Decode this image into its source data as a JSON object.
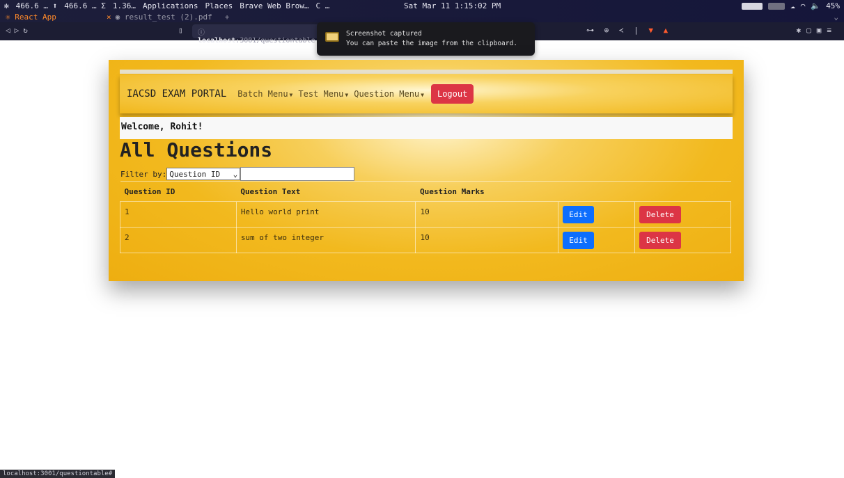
{
  "system_bar": {
    "items": [
      "466.6 … ⬆",
      "466.6 … Σ",
      "1.36…",
      "Applications",
      "Places",
      "Brave Web Brow…",
      "C …"
    ],
    "clock": "Sat Mar 11  1:15:02 PM",
    "battery": "45%"
  },
  "browser": {
    "tabs": [
      {
        "label": "React App",
        "active": true
      },
      {
        "label": "result_test (2).pdf",
        "active": false
      }
    ],
    "url_host": "localhost",
    "url_path": ":3001/questiontable",
    "status_url": "localhost:3001/questiontable#"
  },
  "toast": {
    "title": "Screenshot captured",
    "message": "You can paste the image from the clipboard."
  },
  "app_nav": {
    "brand": "IACSD EXAM PORTAL",
    "menus": [
      "Batch Menu",
      "Test Menu",
      "Question Menu"
    ],
    "logout": "Logout"
  },
  "welcome": "Welcome, Rohit!",
  "page_title": "All Questions",
  "filter": {
    "label": "Filter by:",
    "selected": "Question ID",
    "value": ""
  },
  "table": {
    "headers": [
      "Question ID",
      "Question Text",
      "Question Marks",
      ""
    ],
    "rows": [
      {
        "id": "1",
        "text": "Hello world print",
        "marks": "10",
        "edit": "Edit",
        "delete": "Delete"
      },
      {
        "id": "2",
        "text": "sum of two integer",
        "marks": "10",
        "edit": "Edit",
        "delete": "Delete"
      }
    ]
  },
  "colors": {
    "accent_gold": "#f2b91e",
    "danger": "#dc3545",
    "primary": "#0d6efd"
  }
}
